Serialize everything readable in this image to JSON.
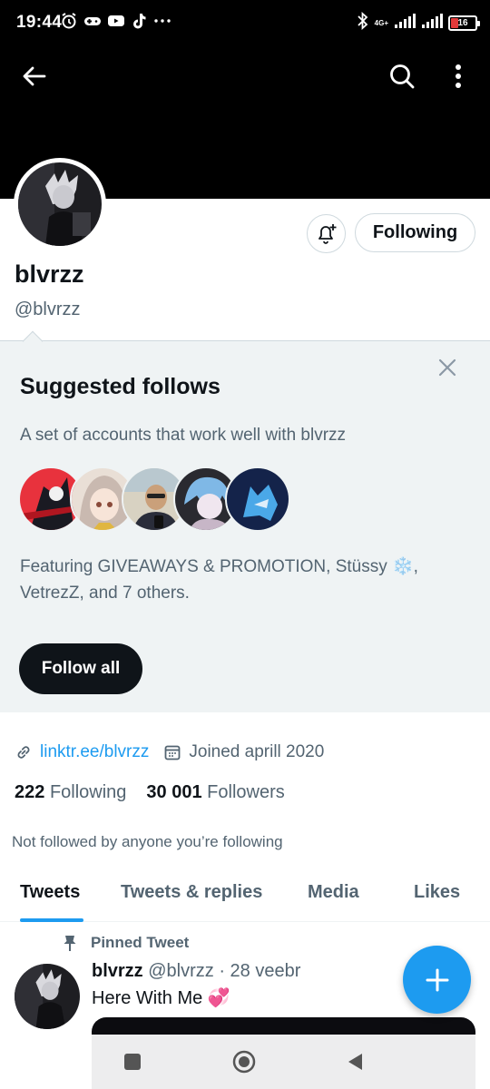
{
  "status_bar": {
    "time": "19:44",
    "network": "4G+",
    "battery": "16"
  },
  "profile": {
    "display_name": "blvrzz",
    "handle": "@blvrzz",
    "follow_button_label": "Following",
    "link": "linktr.ee/blvrzz",
    "joined": "Joined aprill 2020",
    "following_count": "222",
    "following_label": "Following",
    "followers_count": "30 001",
    "followers_label": "Followers",
    "not_followed_note": "Not followed by anyone you’re following"
  },
  "suggested": {
    "title": "Suggested follows",
    "subtitle": "A set of accounts that work well with blvrzz",
    "featuring_line1": "Featuring GIVEAWAYS & PROMOTION, Stüssy ❄️,",
    "featuring_line2": "VetrezZ, and 7 others.",
    "follow_all_label": "Follow all"
  },
  "tabs": [
    {
      "label": "Tweets",
      "active": true
    },
    {
      "label": "Tweets & replies",
      "active": false
    },
    {
      "label": "Media",
      "active": false
    },
    {
      "label": "Likes",
      "active": false
    }
  ],
  "tweet": {
    "pinned_label": "Pinned Tweet",
    "author_name": "blvrzz",
    "author_handle": "@blvrzz",
    "date": "· 28 veebr",
    "text": "Here With Me 💞"
  },
  "colors": {
    "accent": "#1d9bf0",
    "header_bg": "#000000",
    "suggest_bg": "#eff3f4",
    "text_primary": "#0f1419",
    "text_secondary": "#536471"
  }
}
